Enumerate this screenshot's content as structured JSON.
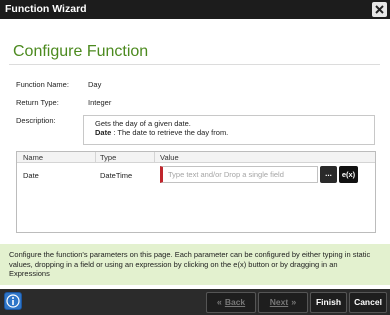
{
  "window": {
    "title": "Function Wizard",
    "close_icon": "close-icon"
  },
  "page": {
    "heading": "Configure Function"
  },
  "fields": {
    "function_name_label": "Function Name:",
    "function_name": "Day",
    "return_type_label": "Return Type:",
    "return_type": "Integer",
    "description_label": "Description:",
    "description_line1": "Gets the day of a given date.",
    "description_param_name": "Date",
    "description_param_text": " : The date to retrieve the day from."
  },
  "parameters": {
    "columns": [
      "Name",
      "Type",
      "Value"
    ],
    "rows": [
      {
        "name": "Date",
        "type": "DateTime",
        "value_placeholder": "Type text and/or Drop a single field",
        "browse_label": "...",
        "expression_label": "e(x)"
      }
    ]
  },
  "help_text": "Configure the function's parameters on this page. Each parameter can be configured by either typing in static values, dropping in a field or using an expression by clicking on the e(x) button or by dragging in an Expressions",
  "footer": {
    "back_label": "Back",
    "next_label": "Next",
    "finish_label": "Finish",
    "cancel_label": "Cancel"
  },
  "colors": {
    "heading": "#4c8a1f",
    "help_background": "#e3f1cf",
    "required_marker": "#c0262d",
    "footer_background": "#2b2b2b"
  }
}
